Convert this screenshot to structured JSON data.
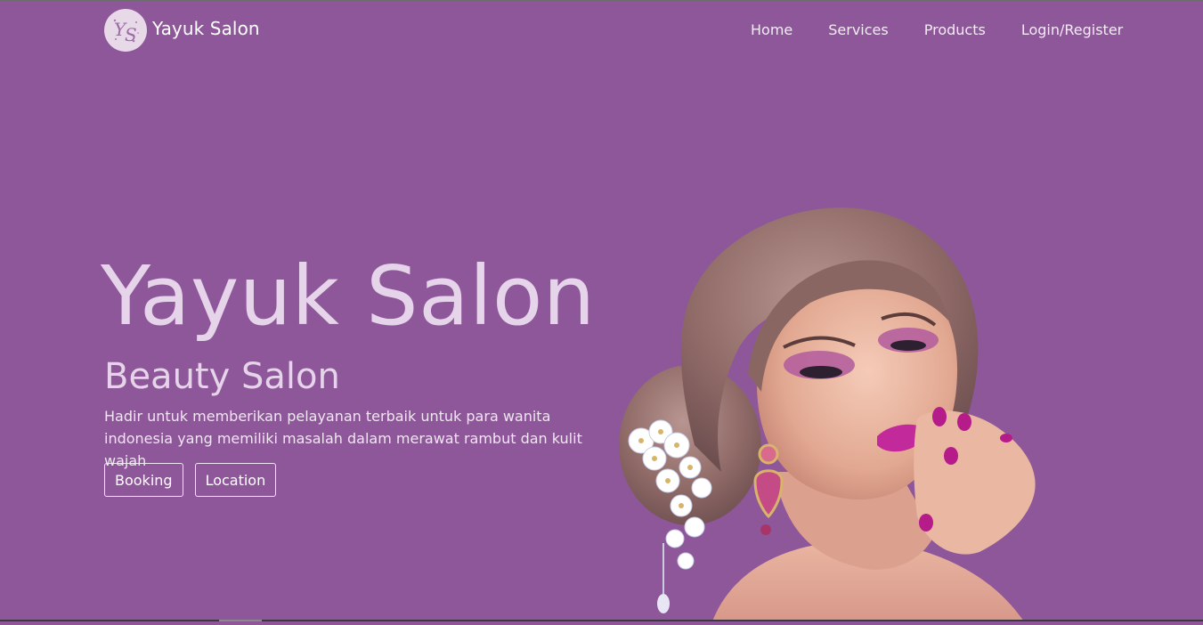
{
  "navbar": {
    "brand_name": "Yayuk Salon",
    "logo_icon": "ys-monogram-icon",
    "links": [
      {
        "label": "Home"
      },
      {
        "label": "Services"
      },
      {
        "label": "Products"
      },
      {
        "label": "Login/Register"
      }
    ]
  },
  "hero": {
    "title": "Yayuk Salon",
    "subtitle": "Beauty Salon",
    "description": "Hadir untuk memberikan pelayanan terbaik untuk para wanita indonesia yang memiliki masalah dalam merawat rambut dan kulit wajah",
    "buttons": {
      "booking": "Booking",
      "location": "Location"
    },
    "image": "woman-with-makeup-and-flower-hairpiece"
  },
  "colors": {
    "background": "#8e5799",
    "title_text": "#e6d4ea",
    "button_border": "#f1e6f3"
  }
}
